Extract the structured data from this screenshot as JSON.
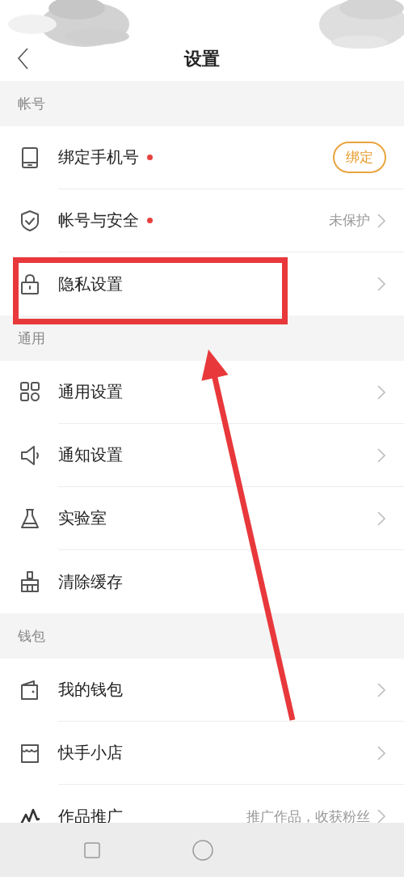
{
  "header": {
    "title": "设置"
  },
  "sections": [
    {
      "title": "帐号",
      "rows": [
        {
          "label": "绑定手机号",
          "dot": true,
          "button": "绑定",
          "chevron": false
        },
        {
          "label": "帐号与安全",
          "dot": true,
          "value": "未保护",
          "chevron": true
        },
        {
          "label": "隐私设置",
          "dot": false,
          "chevron": true
        }
      ]
    },
    {
      "title": "通用",
      "rows": [
        {
          "label": "通用设置",
          "dot": false,
          "chevron": true
        },
        {
          "label": "通知设置",
          "dot": false,
          "chevron": true
        },
        {
          "label": "实验室",
          "dot": false,
          "chevron": true
        },
        {
          "label": "清除缓存",
          "dot": false,
          "chevron": false
        }
      ]
    },
    {
      "title": "钱包",
      "rows": [
        {
          "label": "我的钱包",
          "dot": false,
          "chevron": true
        },
        {
          "label": "快手小店",
          "dot": false,
          "chevron": true
        },
        {
          "label": "作品推广",
          "dot": false,
          "value": "推广作品，收获粉丝",
          "chevron": true
        }
      ]
    }
  ],
  "annotations": [
    {
      "kind": "highlight_box"
    },
    {
      "kind": "arrow"
    }
  ]
}
